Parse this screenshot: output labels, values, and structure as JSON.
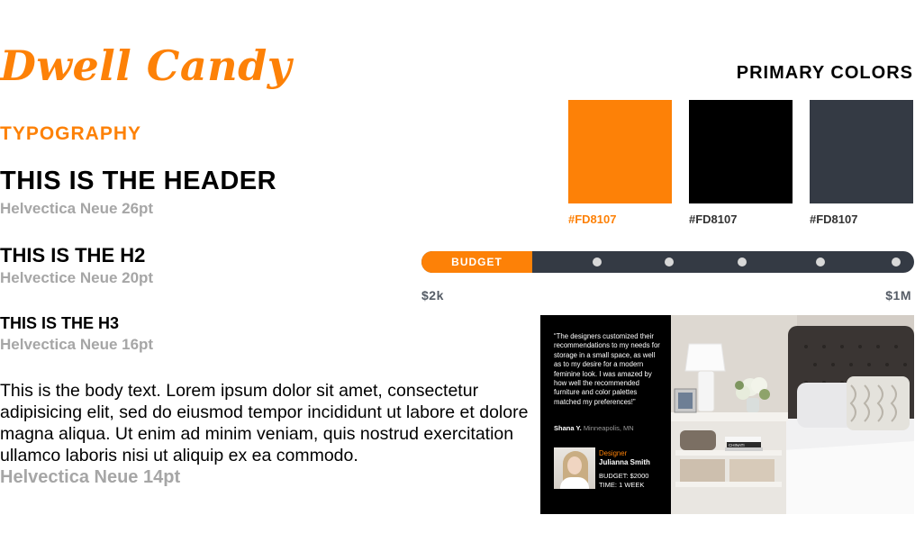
{
  "brand": {
    "logo_text": "Dwell Candy"
  },
  "typography": {
    "section_title": "TYPOGRAPHY",
    "h1": {
      "sample": "THIS IS THE HEADER",
      "spec": "Helvectica Neue 26pt"
    },
    "h2": {
      "sample": "THIS IS THE H2",
      "spec": "Helvectice Neue 20pt"
    },
    "h3": {
      "sample": "THIS IS THE H3",
      "spec": "Helvectica Neue 16pt"
    },
    "body": {
      "sample": "This is the body text. Lorem ipsum dolor sit amet, consectetur adipisicing elit, sed do eiusmod tempor incididunt ut labore et dolore magna aliqua. Ut enim ad minim veniam, quis nostrud exercitation ullamco laboris nisi ut aliquip ex ea commodo.",
      "spec": "Helvectica Neue 14pt"
    }
  },
  "primary_colors": {
    "title": "PRIMARY COLORS",
    "swatches": [
      {
        "label": "#FD8107",
        "color": "#fd8107",
        "label_color": "#fd8107"
      },
      {
        "label": "#FD8107",
        "color": "#000000",
        "label_color": "#333333"
      },
      {
        "label": "#FD8107",
        "color": "#343a44",
        "label_color": "#333333"
      }
    ]
  },
  "budget_slider": {
    "label": "BUDGET",
    "min_label": "$2k",
    "max_label": "$1M",
    "fill_fraction": 0.225,
    "accent": "#fd8107",
    "track_color": "#343a44"
  },
  "testimonial": {
    "quote": "“The designers customized their recommendations to my needs for storage in a small space, as well as to my desire for a modern feminine look. I was amazed by how well the recommended furniture and color palettes matched my preferences!”",
    "author_name": "Shana Y.",
    "author_location": "Minneapolis, MN",
    "designer_role": "Designer",
    "designer_name": "Julianna Smith",
    "budget": "BUDGET: $2000",
    "time": "TIME: 1 WEEK",
    "book_spine_text": "CHINATI"
  }
}
